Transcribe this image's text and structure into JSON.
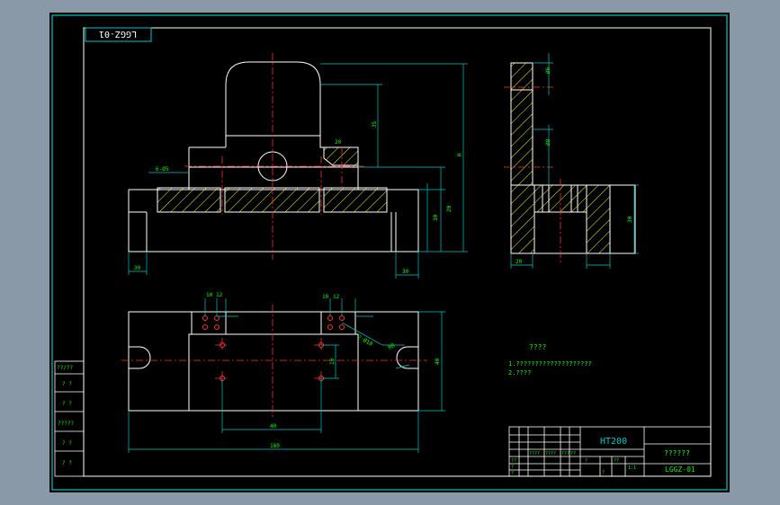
{
  "drawing": {
    "code_stamp": "LGGZ-01",
    "notes": {
      "heading": "????",
      "line1": "1.????????????????????",
      "line2": "2.????"
    },
    "title_block": {
      "material": "HT200",
      "name": "??????",
      "code": "LGGZ-01",
      "cells": [
        "????",
        "????",
        "???",
        "??",
        "??",
        "?",
        "?",
        "?",
        "1:1",
        "??",
        "?"
      ]
    },
    "left_strip": [
      "??/??",
      "? ?",
      "? ?",
      "?????",
      "? ?",
      "? ?"
    ],
    "dimensions": {
      "front": [
        "R",
        "35",
        "20",
        "30",
        "30",
        "30",
        "6-Ø5",
        "20"
      ],
      "side": [
        "Ø6",
        "Ø8",
        "30",
        "20"
      ],
      "top": [
        "10",
        "12",
        "10",
        "12",
        "2-Ø10",
        "M8",
        "40",
        "40",
        "10",
        "160"
      ]
    }
  }
}
